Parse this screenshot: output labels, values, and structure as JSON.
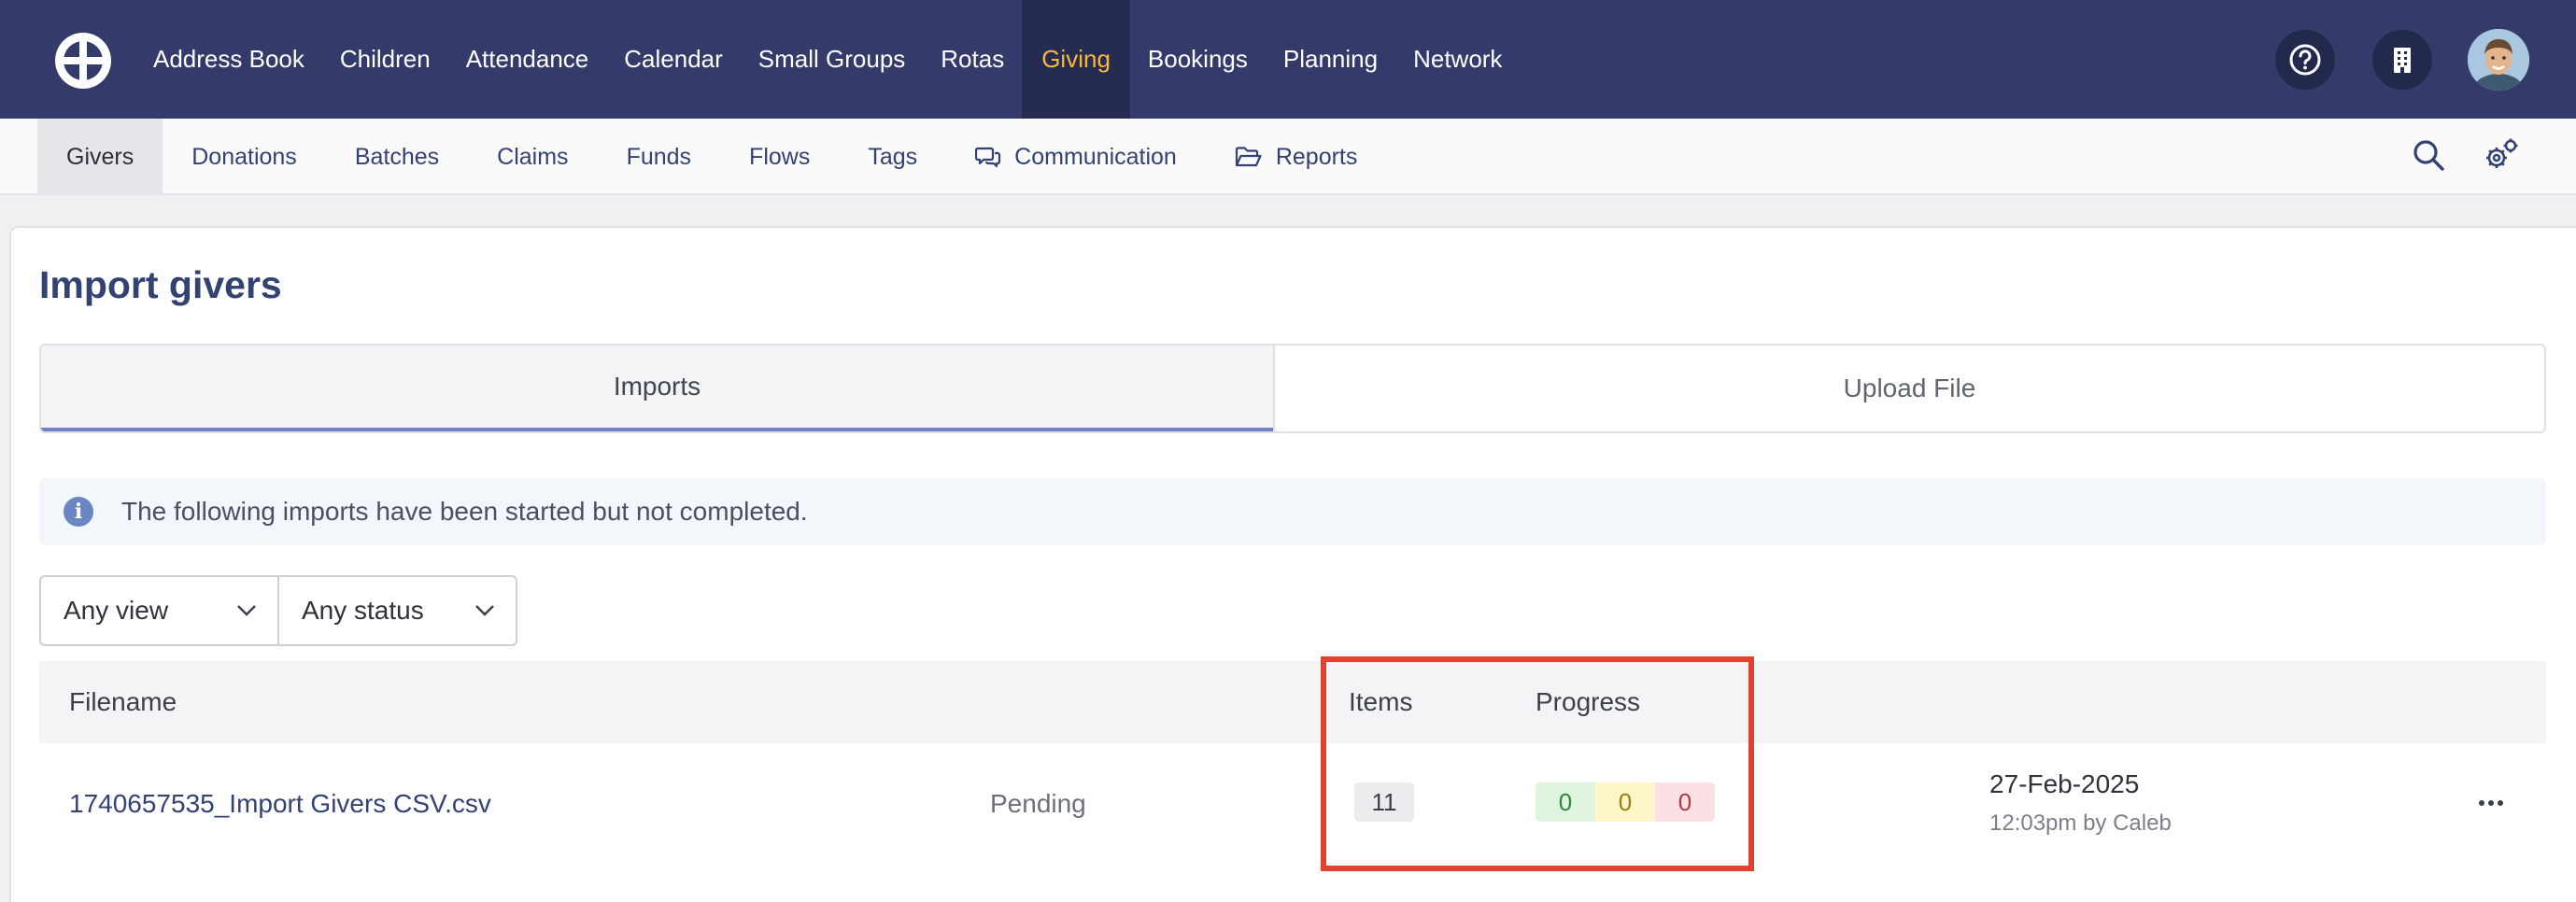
{
  "topnav": {
    "items": [
      "Address Book",
      "Children",
      "Attendance",
      "Calendar",
      "Small Groups",
      "Rotas",
      "Giving",
      "Bookings",
      "Planning",
      "Network"
    ],
    "active": "Giving",
    "icons": [
      "help-icon",
      "building-icon"
    ],
    "accent_color": "#f6b93b",
    "bar_color": "#343b6b"
  },
  "subnav": {
    "items": [
      "Givers",
      "Donations",
      "Batches",
      "Claims",
      "Funds",
      "Flows",
      "Tags",
      "Communication",
      "Reports"
    ],
    "active": "Givers",
    "icons": [
      "search-icon",
      "settings-gears-icon"
    ]
  },
  "page": {
    "title": "Import givers"
  },
  "tabs": {
    "imports": "Imports",
    "upload": "Upload File"
  },
  "info": {
    "text": "The following imports have been started but not completed."
  },
  "filters": {
    "view": "Any view",
    "status": "Any status"
  },
  "table": {
    "headers": {
      "filename": "Filename",
      "items": "Items",
      "progress": "Progress"
    },
    "rows": [
      {
        "filename": "1740657535_Import Givers CSV.csv",
        "status": "Pending",
        "items": "11",
        "progress_ok": "0",
        "progress_pending": "0",
        "progress_error": "0",
        "date": "27-Feb-2025",
        "date_detail": "12:03pm by Caleb"
      }
    ]
  },
  "highlight_color": "#e1412e"
}
